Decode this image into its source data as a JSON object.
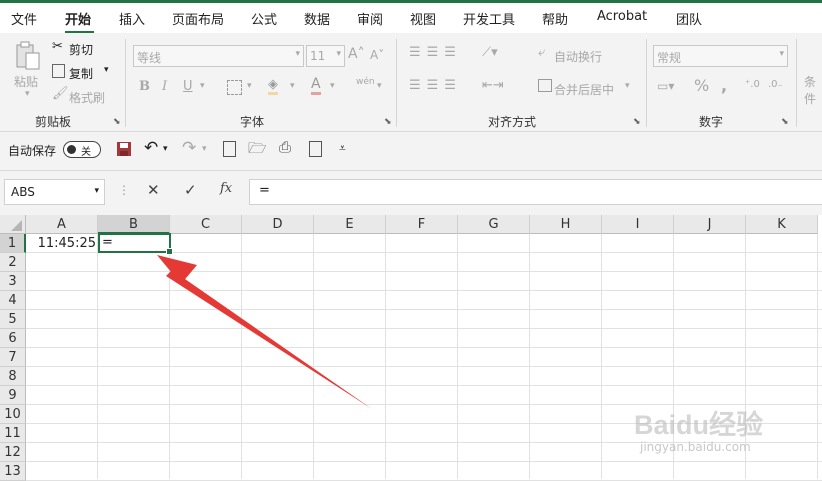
{
  "menu": {
    "tabs": [
      "文件",
      "开始",
      "插入",
      "页面布局",
      "公式",
      "数据",
      "审阅",
      "视图",
      "开发工具",
      "帮助",
      "Acrobat",
      "团队"
    ],
    "active": "开始"
  },
  "ribbon": {
    "clipboard": {
      "paste": "粘贴",
      "cut": "剪切",
      "copy": "复制",
      "format_painter": "格式刷",
      "label": "剪贴板"
    },
    "font": {
      "font_name": "等线",
      "font_size": "11",
      "bold": "B",
      "italic": "I",
      "underline": "U",
      "wen": "wén",
      "label": "字体"
    },
    "align": {
      "wrap": "自动换行",
      "merge": "合并后居中",
      "label": "对齐方式"
    },
    "number": {
      "format": "常规",
      "percent": "%",
      "comma": ",",
      "label": "数字"
    },
    "partial": "条件"
  },
  "qat": {
    "autosave_label": "自动保存",
    "autosave_state": "关"
  },
  "formula_bar": {
    "name_box": "ABS",
    "fx": "fx",
    "content": "="
  },
  "sheet": {
    "columns": [
      "A",
      "B",
      "C",
      "D",
      "E",
      "F",
      "G",
      "H",
      "I",
      "J",
      "K"
    ],
    "rows": [
      "1",
      "2",
      "3",
      "4",
      "5",
      "6",
      "7",
      "8",
      "9",
      "10",
      "11",
      "12",
      "13"
    ],
    "a1": "11:45:25",
    "b1": "=",
    "active_cell": "B1"
  },
  "watermark": {
    "brand": "Baidu经验",
    "url": "jingyan.baidu.com"
  },
  "colors": {
    "accent": "#217346",
    "arrow": "#e53935",
    "save": "#a4373a"
  }
}
